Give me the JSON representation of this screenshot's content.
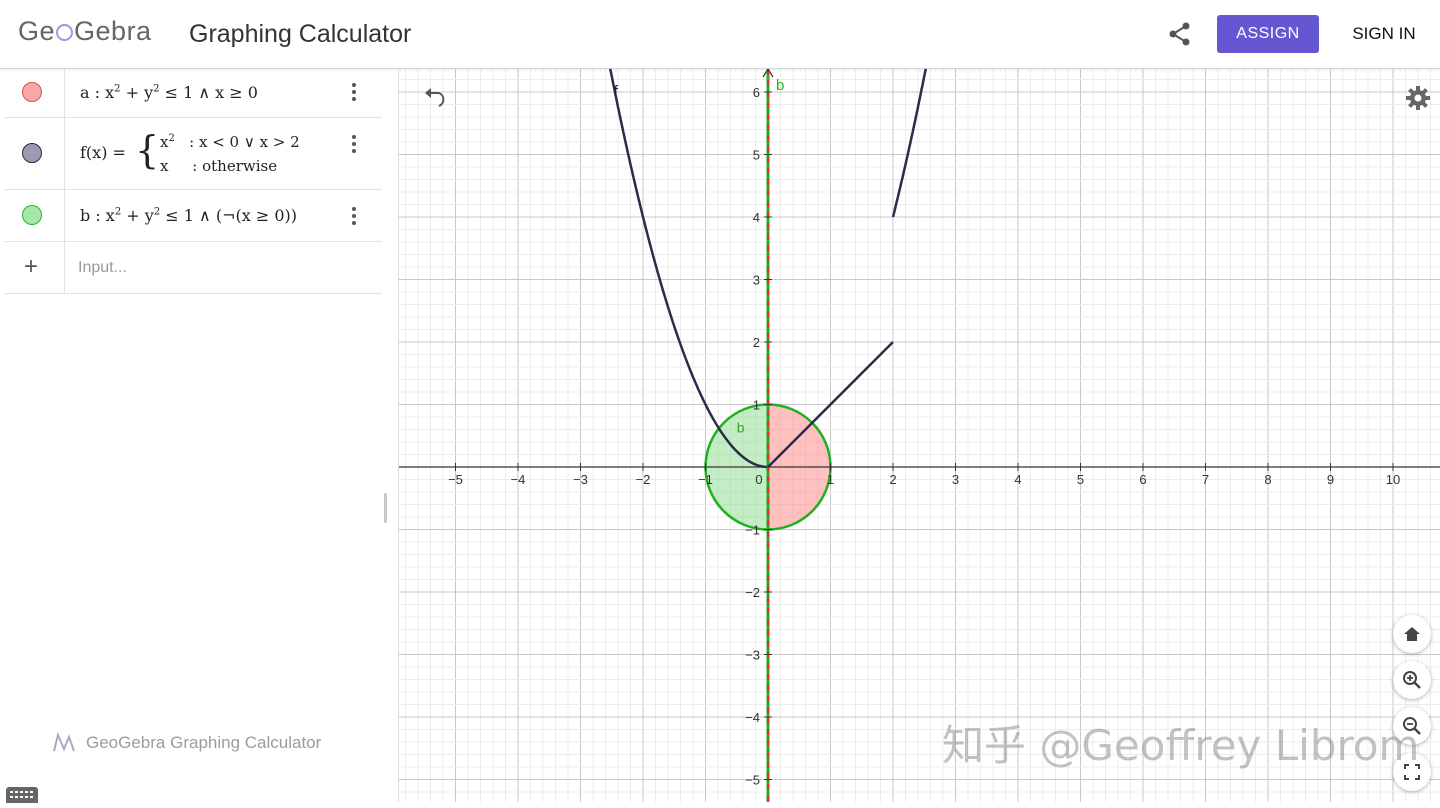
{
  "header": {
    "logo_text": "GeoGebra",
    "app_title": "Graphing Calculator",
    "assign_label": "ASSIGN",
    "signin_label": "SIGN IN",
    "accent_color": "#6557d2"
  },
  "algebra": {
    "rows": [
      {
        "name": "a",
        "color": "#f7a8a8",
        "border": "#d94a4a",
        "text": "a : x² + y² ≤ 1 ∧ x ≥ 0"
      },
      {
        "name": "f",
        "color": "#9a9ab0",
        "border": "#2b2b4a",
        "line1": "x²   : x < 0 ∨ x > 2",
        "line2": "x    : otherwise",
        "label": "f(x) ="
      },
      {
        "name": "b",
        "color": "#a6e6a6",
        "border": "#2fae2f",
        "text": "b : x² + y² ≤ 1 ∧ (¬(x ≥ 0))"
      }
    ],
    "input_placeholder": "Input...",
    "footer_brand": "GeoGebra Graphing Calculator"
  },
  "graph": {
    "x_ticks": [
      "−5",
      "−4",
      "−3",
      "−2",
      "−1",
      "0",
      "1",
      "2",
      "3",
      "4",
      "5",
      "6",
      "7",
      "8",
      "9",
      "10"
    ],
    "y_ticks": [
      "6",
      "5",
      "4",
      "3",
      "2",
      "1",
      "−1",
      "−2",
      "−3",
      "−4",
      "−5"
    ],
    "labels": {
      "f": "f",
      "b_line": "b",
      "b_region": "b"
    },
    "x_range": [
      -5.9,
      10.8
    ],
    "y_range": [
      -5.3,
      6.3
    ]
  },
  "watermark": "知乎 @Geoffrey Librom",
  "icons": [
    "share-icon",
    "undo-icon",
    "gear-icon",
    "home-icon",
    "zoom-in-icon",
    "zoom-out-icon",
    "fullscreen-icon",
    "keyboard-icon",
    "plus-icon"
  ]
}
